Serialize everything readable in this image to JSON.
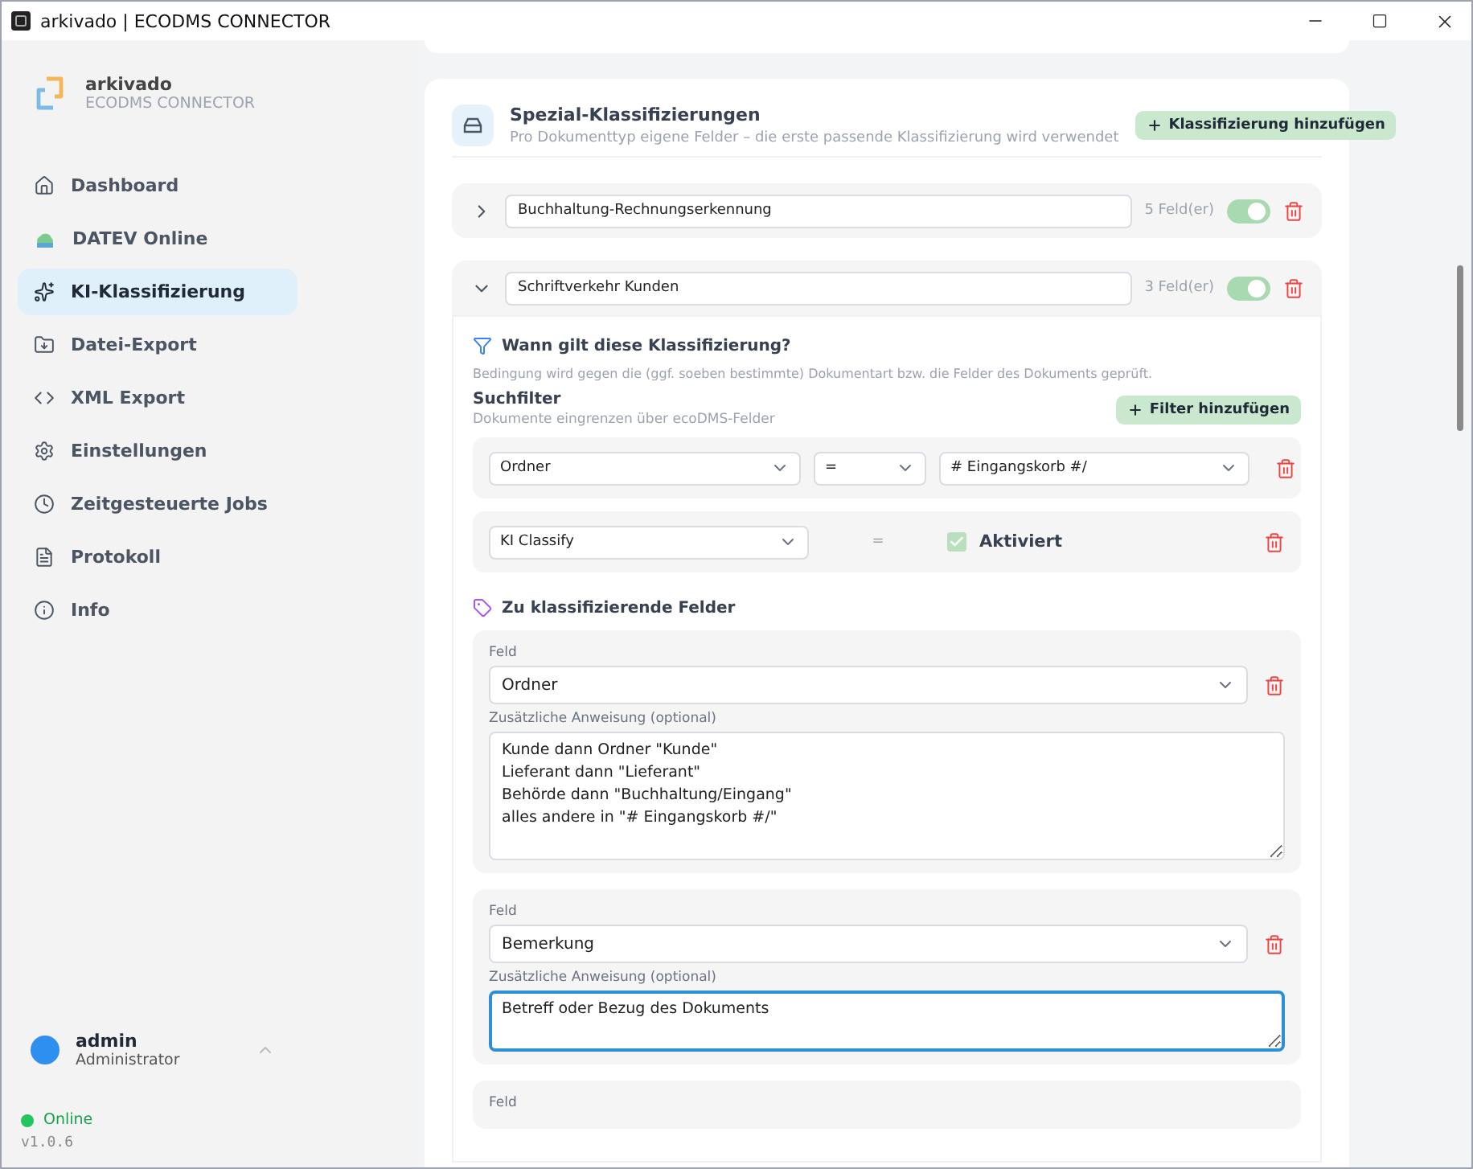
{
  "window": {
    "title": "arkivado | ECODMS CONNECTOR"
  },
  "sidebar": {
    "brand": {
      "name": "arkivado",
      "subtitle": "ECODMS CONNECTOR"
    },
    "items": [
      {
        "label": "Dashboard",
        "selected": false
      },
      {
        "label": "DATEV Online",
        "selected": false
      },
      {
        "label": "KI-Klassifizierung",
        "selected": true
      },
      {
        "label": "Datei-Export",
        "selected": false
      },
      {
        "label": "XML Export",
        "selected": false
      },
      {
        "label": "Einstellungen",
        "selected": false
      },
      {
        "label": "Zeitgesteuerte Jobs",
        "selected": false
      },
      {
        "label": "Protokoll",
        "selected": false
      },
      {
        "label": "Info",
        "selected": false
      }
    ],
    "user": {
      "name": "admin",
      "role": "Administrator"
    },
    "status": {
      "label": "Online",
      "color": "#22c55e"
    },
    "version": "v1.0.6"
  },
  "section": {
    "title": "Spezial-Klassifizierungen",
    "subtitle": "Pro Dokumenttyp eigene Felder – die erste passende Klassifizierung wird verwendet",
    "add_button": "Klassifizierung hinzufügen"
  },
  "classifications": [
    {
      "name": "Buchhaltung-Rechnungserkennung",
      "field_count": "5 Feld(er)",
      "enabled": true,
      "expanded": false
    },
    {
      "name": "Schriftverkehr Kunden",
      "field_count": "3 Feld(er)",
      "enabled": true,
      "expanded": true,
      "condition": {
        "title": "Wann gilt diese Klassifizierung?",
        "description": "Bedingung wird gegen die (ggf. soeben bestimmte) Dokumentart bzw. die Felder des Dokuments geprüft.",
        "filter_title": "Suchfilter",
        "filter_subtitle": "Dokumente eingrenzen über ecoDMS-Felder",
        "add_button": "Filter hinzufügen",
        "rows": [
          {
            "kind": "select",
            "field": "Ordner",
            "operator": "=",
            "value": "# Eingangskorb #/"
          },
          {
            "kind": "checkbox",
            "field": "KI Classify",
            "operator": "=",
            "checked": true,
            "label": "Aktiviert"
          }
        ]
      },
      "fields_title": "Zu klassifizierende Felder",
      "fields": [
        {
          "label": "Feld",
          "value": "Ordner",
          "instruction_label": "Zusätzliche Anweisung (optional)",
          "instruction": "Kunde dann Ordner \"Kunde\"\nLieferant dann \"Lieferant\"\nBehörde dann \"Buchhaltung/Eingang\"\nalles andere in \"# Eingangskorb #/\"",
          "focused": false
        },
        {
          "label": "Feld",
          "value": "Bemerkung",
          "instruction_label": "Zusätzliche Anweisung (optional)",
          "instruction": "Betreff oder Bezug des Dokuments",
          "focused": true
        },
        {
          "label": "Feld"
        }
      ]
    }
  ]
}
